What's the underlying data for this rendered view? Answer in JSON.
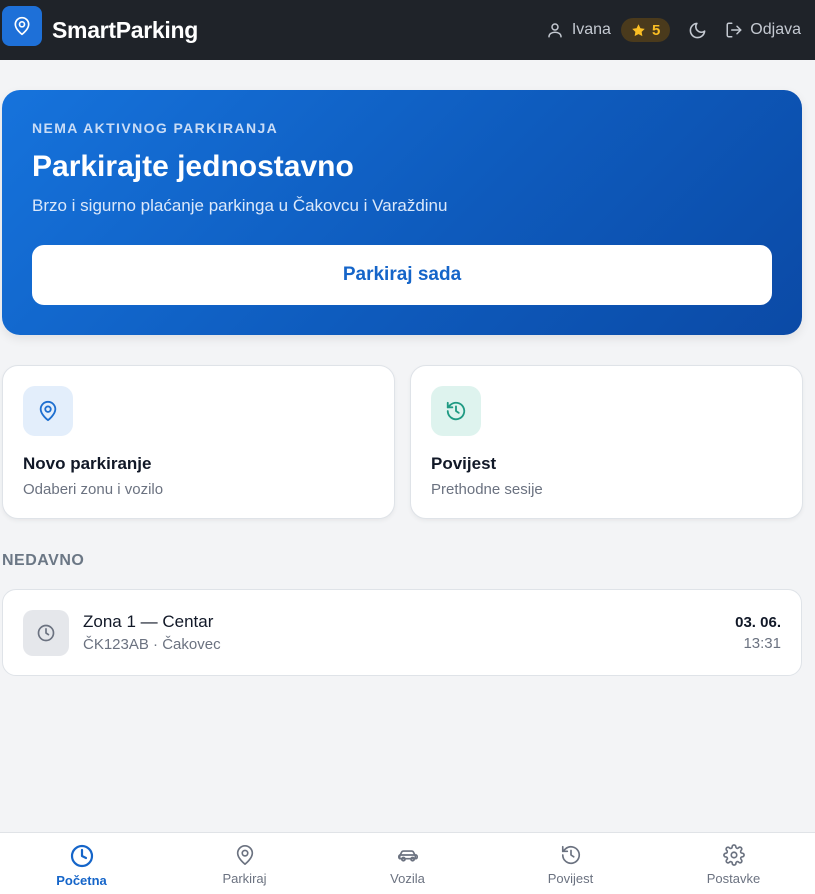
{
  "header": {
    "app_title": "SmartParking",
    "user_name": "Ivana",
    "points": "5",
    "logout_label": "Odjava",
    "logo_icon": "map-pin-icon",
    "star_color": "#fbbf24"
  },
  "hero": {
    "kicker": "NEMA AKTIVNOG PARKIRANJA",
    "title": "Parkirajte jednostavno",
    "subtitle": "Brzo i sigurno plaćanje parkinga u Čakovcu i Varaždinu",
    "button_label": "Parkiraj sada",
    "gradient": [
      "#1673dc",
      "#0b4aa6"
    ]
  },
  "actions": [
    {
      "title": "Novo parkiranje",
      "subtitle": "Odaberi zonu i vozilo",
      "icon": "map-pin-icon"
    },
    {
      "title": "Povijest",
      "subtitle": "Prethodne sesije",
      "icon": "history-icon"
    }
  ],
  "recent": {
    "section_label": "NEDAVNO",
    "items": [
      {
        "zone": "Zona 1 — Centar",
        "meta": "ČK123AB · Čakovec",
        "date": "03. 06.",
        "time": "13:31",
        "icon": "clock-icon"
      }
    ]
  },
  "nav": {
    "active": "Početna",
    "items": [
      {
        "label": "Početna",
        "icon": "clock-icon"
      },
      {
        "label": "Parkiraj",
        "icon": "map-pin-icon"
      },
      {
        "label": "Vozila",
        "icon": "car-icon"
      },
      {
        "label": "Povijest",
        "icon": "history-icon"
      },
      {
        "label": "Postavke",
        "icon": "gear-icon"
      }
    ],
    "accent_color": "#1565c9"
  }
}
